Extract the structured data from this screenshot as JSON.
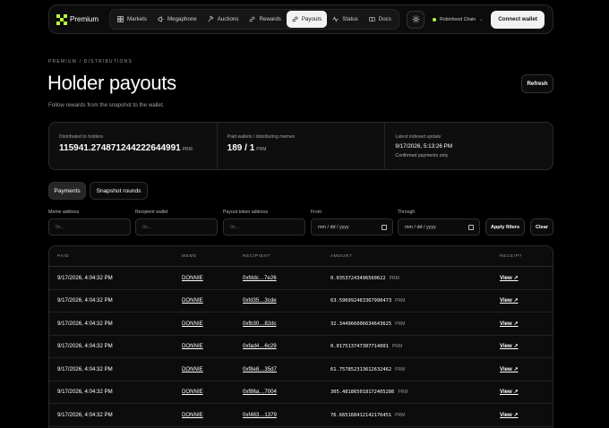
{
  "nav": {
    "brand": "Premium",
    "links": [
      {
        "label": "Markets",
        "icon": "grid-icon"
      },
      {
        "label": "Megaphone",
        "icon": "megaphone-icon"
      },
      {
        "label": "Auctions",
        "icon": "gavel-icon"
      },
      {
        "label": "Rewards",
        "icon": "link-icon"
      },
      {
        "label": "Payouts",
        "icon": "link-icon",
        "active": true
      },
      {
        "label": "Status",
        "icon": "pulse-icon"
      },
      {
        "label": "Docs",
        "icon": "doc-icon"
      }
    ],
    "chain": "Robinhood Chain",
    "connect": "Connect wallet",
    "accent": "#b6ff3b"
  },
  "breadcrumb": "PREMIUM / DISTRIBUTIONS",
  "page": {
    "title": "Holder payouts",
    "subtitle": "Follow rewards from the snapshot to the wallet.",
    "refresh": "Refresh"
  },
  "stats": {
    "distributed_label": "Distributed to holders",
    "distributed_value": "115941.274871244222644991",
    "distributed_unit": "PRM",
    "wallets_label": "Paid wallets / distributing memes",
    "wallets_value": "189 / 1",
    "wallets_unit": "PRM",
    "indexed_label": "Latest indexed update",
    "indexed_value": "9/17/2026, 5:13:26 PM",
    "indexed_note": "Confirmed payments only"
  },
  "tabs": {
    "payments": "Payments",
    "snapshots": "Snapshot rounds"
  },
  "filters": {
    "meme_label": "Meme address",
    "meme_placeholder": "0x...",
    "recipient_label": "Recipient wallet",
    "recipient_placeholder": "0x...",
    "token_label": "Payout token address",
    "token_placeholder": "0x...",
    "from_label": "From",
    "from_value": "mm / dd / yyyy",
    "through_label": "Through",
    "through_value": "mm / dd / yyyy",
    "apply": "Apply filters",
    "clear": "Clear"
  },
  "table": {
    "headers": {
      "paid": "PAID",
      "meme": "MEME",
      "recipient": "RECIPIENT",
      "amount": "AMOUNT",
      "receipt": "RECEIPT"
    },
    "rows": [
      {
        "paid": "9/17/2026, 4:04:32 PM",
        "meme": "DONNIE",
        "recipient": "0xfddc…7e26",
        "amount": "0.03537243496560622",
        "unit": "PRM",
        "receipt": "View ↗"
      },
      {
        "paid": "9/17/2026, 4:04:32 PM",
        "meme": "DONNIE",
        "recipient": "0xfd35…3cde",
        "amount": "63.596992463367990473",
        "unit": "PRM",
        "receipt": "View ↗"
      },
      {
        "paid": "9/17/2026, 4:04:32 PM",
        "meme": "DONNIE",
        "recipient": "0xfb30…82dc",
        "amount": "32.344966006634643625",
        "unit": "PRM",
        "receipt": "View ↗"
      },
      {
        "paid": "9/17/2026, 4:04:32 PM",
        "meme": "DONNIE",
        "recipient": "0xfad4…6c29",
        "amount": "0.017513747307714001",
        "unit": "PRM",
        "receipt": "View ↗"
      },
      {
        "paid": "9/17/2026, 4:04:32 PM",
        "meme": "DONNIE",
        "recipient": "0xf8e8…35d7",
        "amount": "61.757852313612632462",
        "unit": "PRM",
        "receipt": "View ↗"
      },
      {
        "paid": "9/17/2026, 4:04:32 PM",
        "meme": "DONNIE",
        "recipient": "0xf86a…7004",
        "amount": "305.481865018172405286",
        "unit": "PRM",
        "receipt": "View ↗"
      },
      {
        "paid": "9/17/2026, 4:04:32 PM",
        "meme": "DONNIE",
        "recipient": "0xf483…1379",
        "amount": "76.665168412142176451",
        "unit": "PRM",
        "receipt": "View ↗"
      }
    ]
  }
}
